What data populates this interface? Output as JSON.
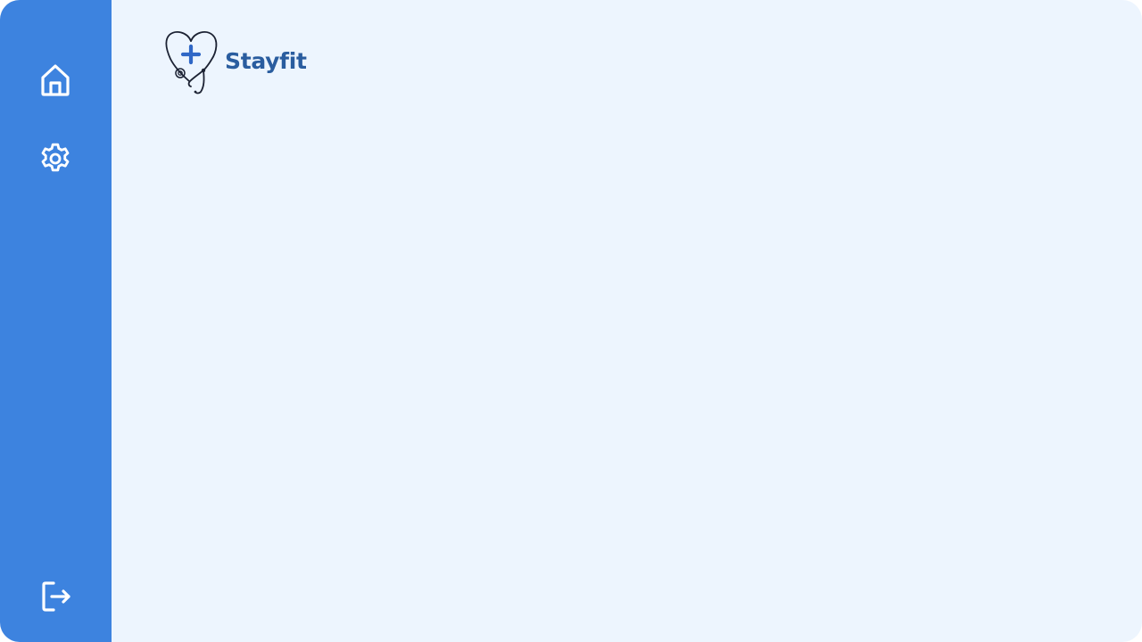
{
  "app": {
    "brand_name": "Stayfit"
  },
  "sidebar": {
    "items": [
      {
        "icon": "home-icon"
      },
      {
        "icon": "gear-icon"
      }
    ],
    "footer": {
      "icon": "logout-icon"
    }
  },
  "colors": {
    "sidebar": "#3d83df",
    "background": "#edf5fe",
    "brand_text": "#2a5d9f",
    "logo_cross": "#2f67c6",
    "logo_outline": "#1c2233"
  }
}
